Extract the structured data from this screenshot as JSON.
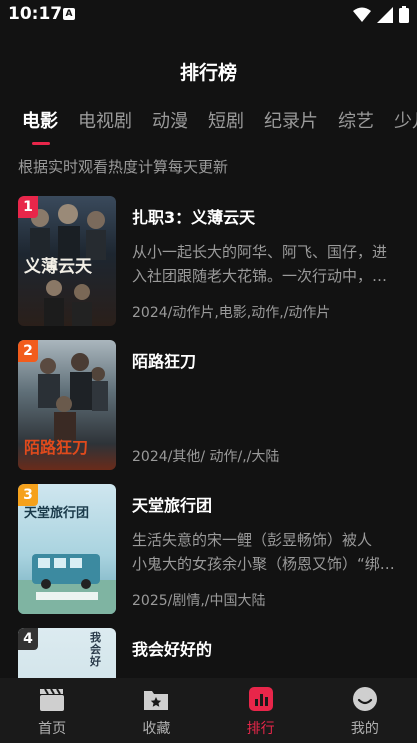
{
  "status_bar": {
    "time": "10:17",
    "badge": "A"
  },
  "header": {
    "title": "排行榜"
  },
  "tabs": [
    {
      "label": "电影",
      "active": true
    },
    {
      "label": "电视剧",
      "active": false
    },
    {
      "label": "动漫",
      "active": false
    },
    {
      "label": "短剧",
      "active": false
    },
    {
      "label": "纪录片",
      "active": false
    },
    {
      "label": "综艺",
      "active": false
    },
    {
      "label": "少儿",
      "active": false
    }
  ],
  "subtitle": "根据实时观看热度计算每天更新",
  "items": [
    {
      "rank": "1",
      "rank_color": "#e8264a",
      "title": "扎职3：义薄云天",
      "desc_line1": "从小一起长大的阿华、阿飞、国仔，进",
      "desc_line2": "入社团跟随老大花锦。一次行动中，…",
      "meta": "2024/动作片,电影,动作,/动作片",
      "poster_text": "义薄云天"
    },
    {
      "rank": "2",
      "rank_color": "#f25c1c",
      "title": "陌路狂刀",
      "desc_line1": "",
      "desc_line2": "",
      "meta": "2024/其他/ 动作/,/大陆",
      "poster_text": "陌路狂刀"
    },
    {
      "rank": "3",
      "rank_color": "#f5a11c",
      "title": "天堂旅行团",
      "desc_line1": "生活失意的宋一鲤（彭昱畅饰）被人",
      "desc_line2": "小鬼大的女孩余小聚（杨恩又饰）“绑…",
      "meta": "2025/剧情,/中国大陆",
      "poster_text": "天堂旅行团"
    },
    {
      "rank": "4",
      "rank_color": "#333333",
      "title": "我会好好的",
      "desc_line1": "",
      "desc_line2": "",
      "meta": "",
      "poster_text": "我会好"
    }
  ],
  "bottom_nav": [
    {
      "label": "首页",
      "icon": "clapperboard-icon",
      "active": false
    },
    {
      "label": "收藏",
      "icon": "bookmark-folder-icon",
      "active": false
    },
    {
      "label": "排行",
      "icon": "ranking-chart-icon",
      "active": true
    },
    {
      "label": "我的",
      "icon": "smile-face-icon",
      "active": false
    }
  ],
  "colors": {
    "accent": "#e8264a",
    "background": "#121212"
  }
}
